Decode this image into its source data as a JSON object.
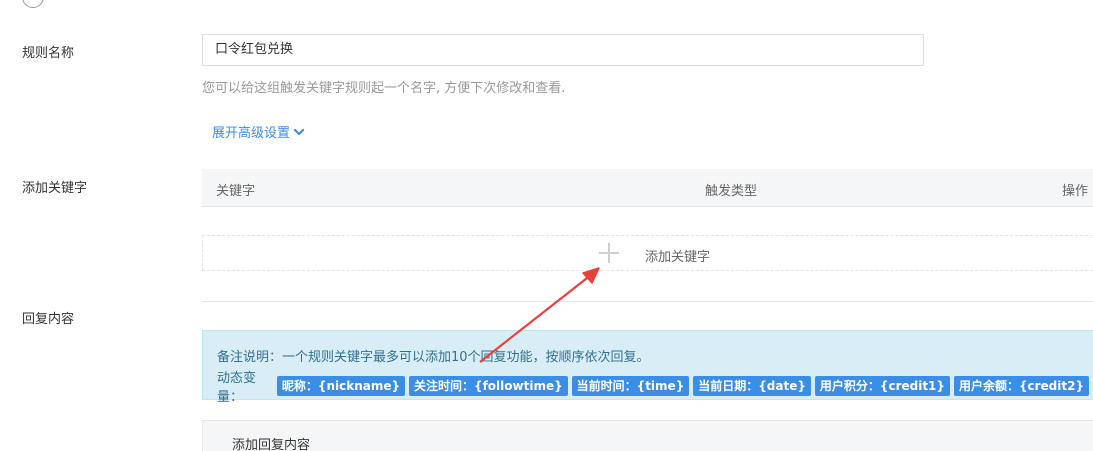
{
  "form": {
    "rule_name_label": "规则名称",
    "rule_name_value": "口令红包兑换",
    "rule_name_hint": "您可以给这组触发关键字规则起一个名字, 方便下次修改和查看.",
    "advanced_toggle": "展开高级设置",
    "add_keyword_label": "添加关键字",
    "reply_content_label": "回复内容"
  },
  "keyword_table": {
    "columns": [
      "关键字",
      "触发类型",
      "操作"
    ],
    "add_keyword_text": "添加关键字"
  },
  "note": {
    "text": "备注说明：一个规则关键字最多可以添加10个回复功能，按顺序依次回复。",
    "vars_label": "动态变量：",
    "variables": [
      "昵称：{nickname}",
      "关注时间：{followtime}",
      "当前时间：{time}",
      "当前日期：{date}",
      "用户积分：{credit1}",
      "用户余额：{credit2}"
    ]
  },
  "reply": {
    "add_reply_text": "添加回复内容"
  },
  "colors": {
    "accent": "#3a8ee6",
    "note_bg": "#d9edf7",
    "annotation_arrow": "#e8413b"
  }
}
